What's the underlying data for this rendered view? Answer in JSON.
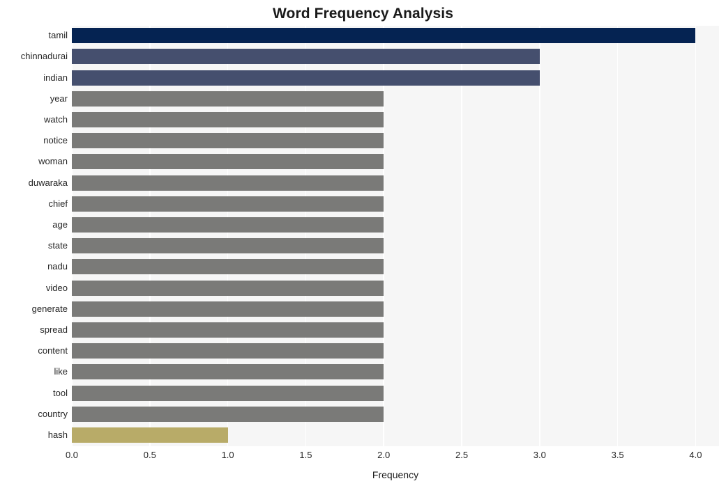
{
  "chart_data": {
    "type": "bar",
    "orientation": "horizontal",
    "title": "Word Frequency Analysis",
    "xlabel": "Frequency",
    "ylabel": "",
    "xlim": [
      0,
      4.15
    ],
    "xticks": [
      "0.0",
      "0.5",
      "1.0",
      "1.5",
      "2.0",
      "2.5",
      "3.0",
      "3.5",
      "4.0"
    ],
    "xtick_values": [
      0.0,
      0.5,
      1.0,
      1.5,
      2.0,
      2.5,
      3.0,
      3.5,
      4.0
    ],
    "grid": "vertical",
    "legend": "none",
    "categories": [
      "tamil",
      "chinnadurai",
      "indian",
      "year",
      "watch",
      "notice",
      "woman",
      "duwaraka",
      "chief",
      "age",
      "state",
      "nadu",
      "video",
      "generate",
      "spread",
      "content",
      "like",
      "tool",
      "country",
      "hash"
    ],
    "values": [
      4,
      3,
      3,
      2,
      2,
      2,
      2,
      2,
      2,
      2,
      2,
      2,
      2,
      2,
      2,
      2,
      2,
      2,
      2,
      1
    ],
    "bar_colors": [
      "#052352",
      "#454f6e",
      "#454f6e",
      "#7a7a78",
      "#7a7a78",
      "#7a7a78",
      "#7a7a78",
      "#7a7a78",
      "#7a7a78",
      "#7a7a78",
      "#7a7a78",
      "#7a7a78",
      "#7a7a78",
      "#7a7a78",
      "#7a7a78",
      "#7a7a78",
      "#7a7a78",
      "#7a7a78",
      "#7a7a78",
      "#b8ab68"
    ]
  },
  "style": {
    "plot_background": "#f6f6f6",
    "figure_background": "#ffffff",
    "gridline_color": "#ffffff",
    "text_color": "#262626"
  }
}
